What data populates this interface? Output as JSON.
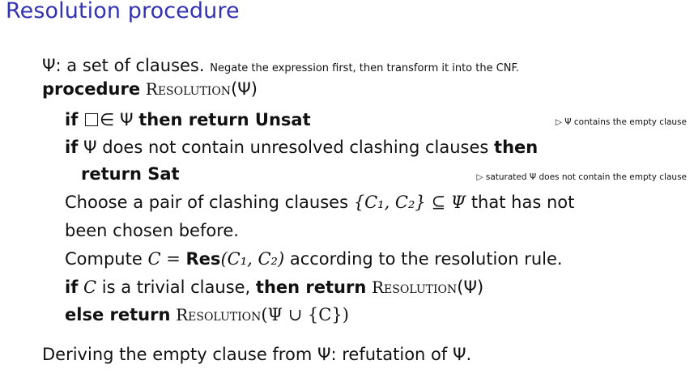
{
  "title": "Resolution procedure",
  "psi": "Ψ",
  "intro": {
    "text": ": a set of clauses.",
    "note": "Negate the expression first, then transform it into the CNF."
  },
  "procedure": {
    "keyword": "procedure",
    "name": "Resolution",
    "arg": "(Ψ)"
  },
  "line_if1": {
    "if": "if",
    "in": "∈ Ψ",
    "then_return": "then return Unsat",
    "comment": "▷ Ψ contains the empty clause"
  },
  "line_if2": {
    "if": "if",
    "text": "Ψ does not contain unresolved clashing clauses",
    "then": "then"
  },
  "line_return_sat": {
    "text": "return Sat",
    "comment": "▷ saturated Ψ does not contain the empty clause"
  },
  "line_choose": {
    "line1_a": "Choose a pair of clashing clauses",
    "line1_math": "{C₁, C₂} ⊆ Ψ",
    "line1_b": "that has not",
    "line2": "been chosen before."
  },
  "line_compute": {
    "a": "Compute",
    "c": "C",
    "eq": "=",
    "res": "Res",
    "args": "(C₁, C₂)",
    "b": "according to the resolution rule."
  },
  "line_if3": {
    "if": "if",
    "c": "C",
    "text": "is a trivial clause,",
    "then_return": "then return",
    "name": "Resolution",
    "arg": "(Ψ)"
  },
  "line_else": {
    "else_return": "else return",
    "name": "Resolution",
    "arg": "(Ψ ∪ {C})"
  },
  "footer": "Deriving the empty clause from Ψ: refutation of Ψ."
}
